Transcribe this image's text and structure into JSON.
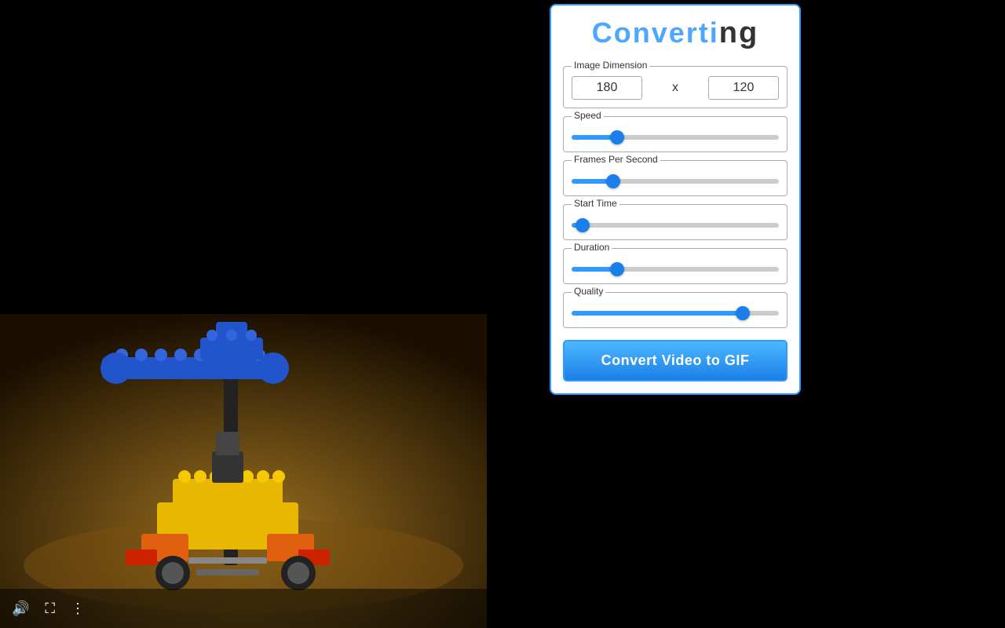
{
  "app": {
    "title": "Converting",
    "title_suffix": "ng"
  },
  "panel": {
    "title_main": "Converti",
    "title_ng": "ng",
    "image_dimension_label": "Image Dimension",
    "width_value": "180",
    "height_value": "120",
    "separator": "x",
    "speed_label": "Speed",
    "speed_value": 20,
    "fps_label": "Frames Per Second",
    "fps_value": 18,
    "start_time_label": "Start Time",
    "start_time_value": 2,
    "duration_label": "Duration",
    "duration_value": 20,
    "quality_label": "Quality",
    "quality_value": 85,
    "convert_button_label": "Convert Video to GIF"
  },
  "video_controls": {
    "volume_icon": "🔊",
    "fullscreen_icon": "⛶",
    "menu_icon": "⋮"
  },
  "colors": {
    "accent": "#3399ff",
    "button_bg": "#1a7fe8",
    "title_color": "#4da6ff",
    "border": "#3399ff"
  }
}
